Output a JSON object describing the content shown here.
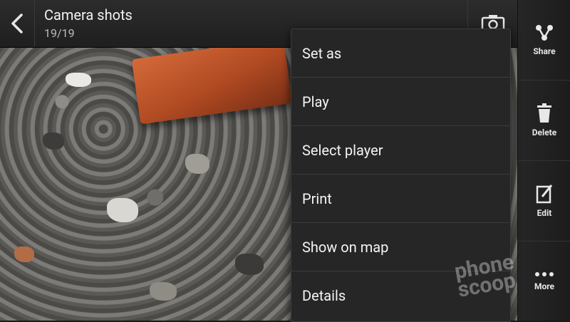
{
  "header": {
    "title": "Camera shots",
    "counter": "19/19",
    "back_icon": "back-chevron-icon",
    "camera_icon": "camera-icon"
  },
  "menu": {
    "items": [
      {
        "label": "Set as"
      },
      {
        "label": "Play"
      },
      {
        "label": "Select player"
      },
      {
        "label": "Print"
      },
      {
        "label": "Show on map"
      },
      {
        "label": "Details"
      }
    ]
  },
  "sidebar": {
    "items": [
      {
        "label": "Share",
        "icon": "share-icon"
      },
      {
        "label": "Delete",
        "icon": "trash-icon"
      },
      {
        "label": "Edit",
        "icon": "edit-icon"
      },
      {
        "label": "More",
        "icon": "more-icon"
      }
    ]
  },
  "watermark": {
    "text_line1": "phone",
    "text_line2": "scoop"
  },
  "colors": {
    "menu_bg": "#262626",
    "bar_bg": "#2c2c2c",
    "brick": "#c45a2c"
  }
}
